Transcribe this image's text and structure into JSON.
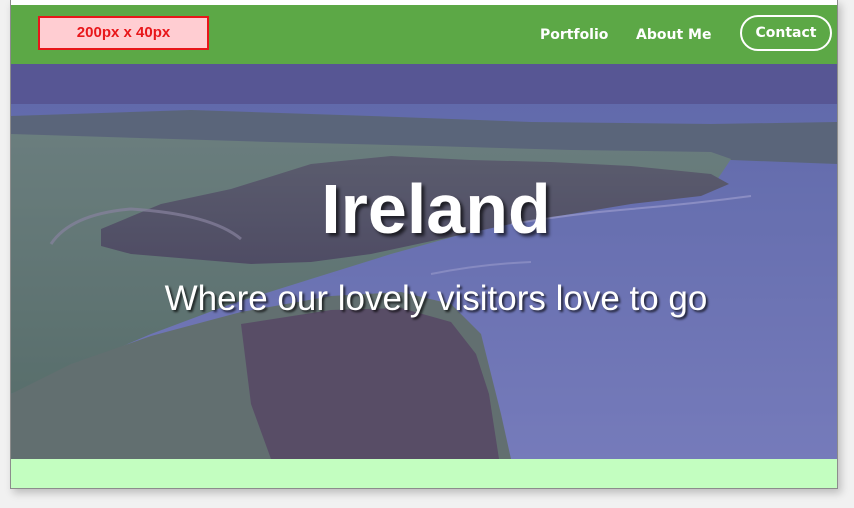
{
  "navbar": {
    "logo_text": "200px x 40px",
    "links": [
      {
        "label": "Portfolio"
      },
      {
        "label": "About Me"
      }
    ],
    "contact_label": "Contact"
  },
  "hero": {
    "title": "Ireland",
    "subtitle": "Where our lovely visitors love to go"
  },
  "colors": {
    "navbar_green": "#5ca846",
    "logo_red": "#e8161a",
    "logo_fill": "#ffcdd2",
    "hero_overlay": "#6b5fb3",
    "footer_green": "#c3fec0"
  }
}
